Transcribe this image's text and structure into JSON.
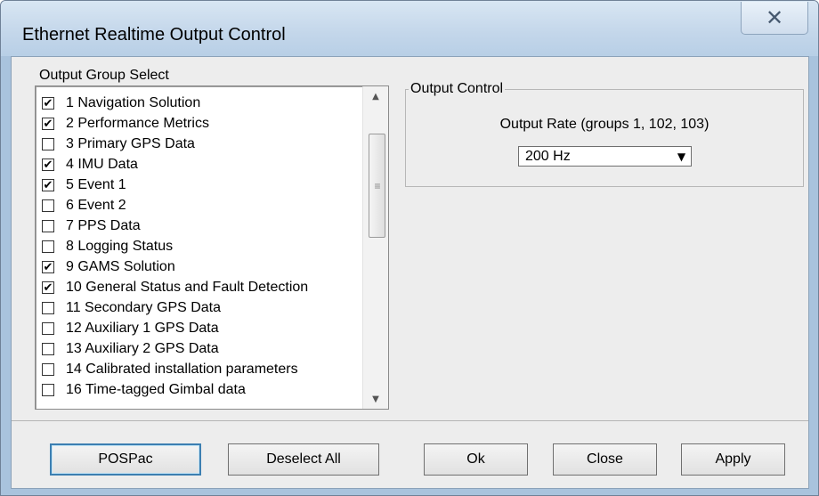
{
  "window": {
    "title": "Ethernet Realtime Output Control",
    "close_glyph": "✕"
  },
  "output_group": {
    "label": "Output Group Select",
    "items": [
      {
        "label": "1 Navigation Solution",
        "checked": true
      },
      {
        "label": "2 Performance Metrics",
        "checked": true
      },
      {
        "label": "3 Primary GPS Data",
        "checked": false
      },
      {
        "label": "4 IMU Data",
        "checked": true
      },
      {
        "label": "5 Event 1",
        "checked": true
      },
      {
        "label": "6 Event 2",
        "checked": false
      },
      {
        "label": "7 PPS Data",
        "checked": false
      },
      {
        "label": "8 Logging Status",
        "checked": false
      },
      {
        "label": "9 GAMS Solution",
        "checked": true
      },
      {
        "label": "10 General Status and Fault Detection",
        "checked": true
      },
      {
        "label": "11 Secondary GPS Data",
        "checked": false
      },
      {
        "label": "12 Auxiliary 1 GPS Data",
        "checked": false
      },
      {
        "label": "13 Auxiliary 2 GPS Data",
        "checked": false
      },
      {
        "label": "14 Calibrated installation parameters",
        "checked": false
      },
      {
        "label": "16 Time-tagged Gimbal data",
        "checked": false
      }
    ]
  },
  "output_control": {
    "label": "Output Control",
    "rate_label": "Output Rate (groups 1, 102, 103)",
    "rate_value": "200 Hz"
  },
  "buttons": {
    "pospac": "POSPac",
    "deselect_all": "Deselect All",
    "ok": "Ok",
    "close": "Close",
    "apply": "Apply"
  },
  "icons": {
    "check": "✔",
    "scroll_up": "▲",
    "scroll_down": "▼",
    "grip": "≡",
    "dropdown": "▼"
  }
}
